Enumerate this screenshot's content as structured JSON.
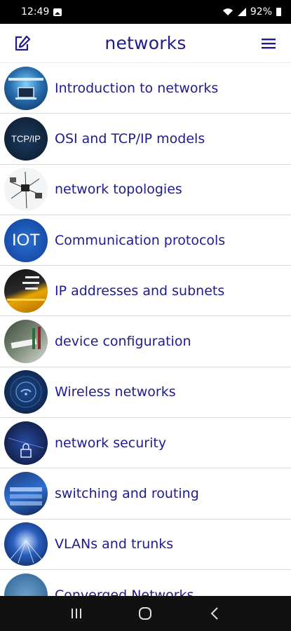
{
  "status": {
    "time": "12:49",
    "battery": "92%"
  },
  "header": {
    "title": "networks"
  },
  "topics": [
    {
      "label": "Introduction to networks",
      "thumb_icon": "laptop-network-icon"
    },
    {
      "label": "OSI and TCP/IP models",
      "thumb_icon": "tcp-ip-icon",
      "thumb_text": "TCP/IP"
    },
    {
      "label": "network topologies",
      "thumb_icon": "topology-icon"
    },
    {
      "label": "Communication protocols",
      "thumb_icon": "iot-icon",
      "thumb_text": "IOT"
    },
    {
      "label": "IP addresses and subnets",
      "thumb_icon": "ip-address-icon"
    },
    {
      "label": "device configuration",
      "thumb_icon": "cable-icon"
    },
    {
      "label": "Wireless networks",
      "thumb_icon": "wifi-icon"
    },
    {
      "label": "network security",
      "thumb_icon": "lock-icon"
    },
    {
      "label": "switching and routing",
      "thumb_icon": "switch-icon"
    },
    {
      "label": "VLANs and trunks",
      "thumb_icon": "server-icon"
    },
    {
      "label": "Converged Networks",
      "thumb_icon": "converged-icon"
    }
  ],
  "colors": {
    "accent": "#1f1b8f",
    "divider": "#d9d9d9"
  }
}
